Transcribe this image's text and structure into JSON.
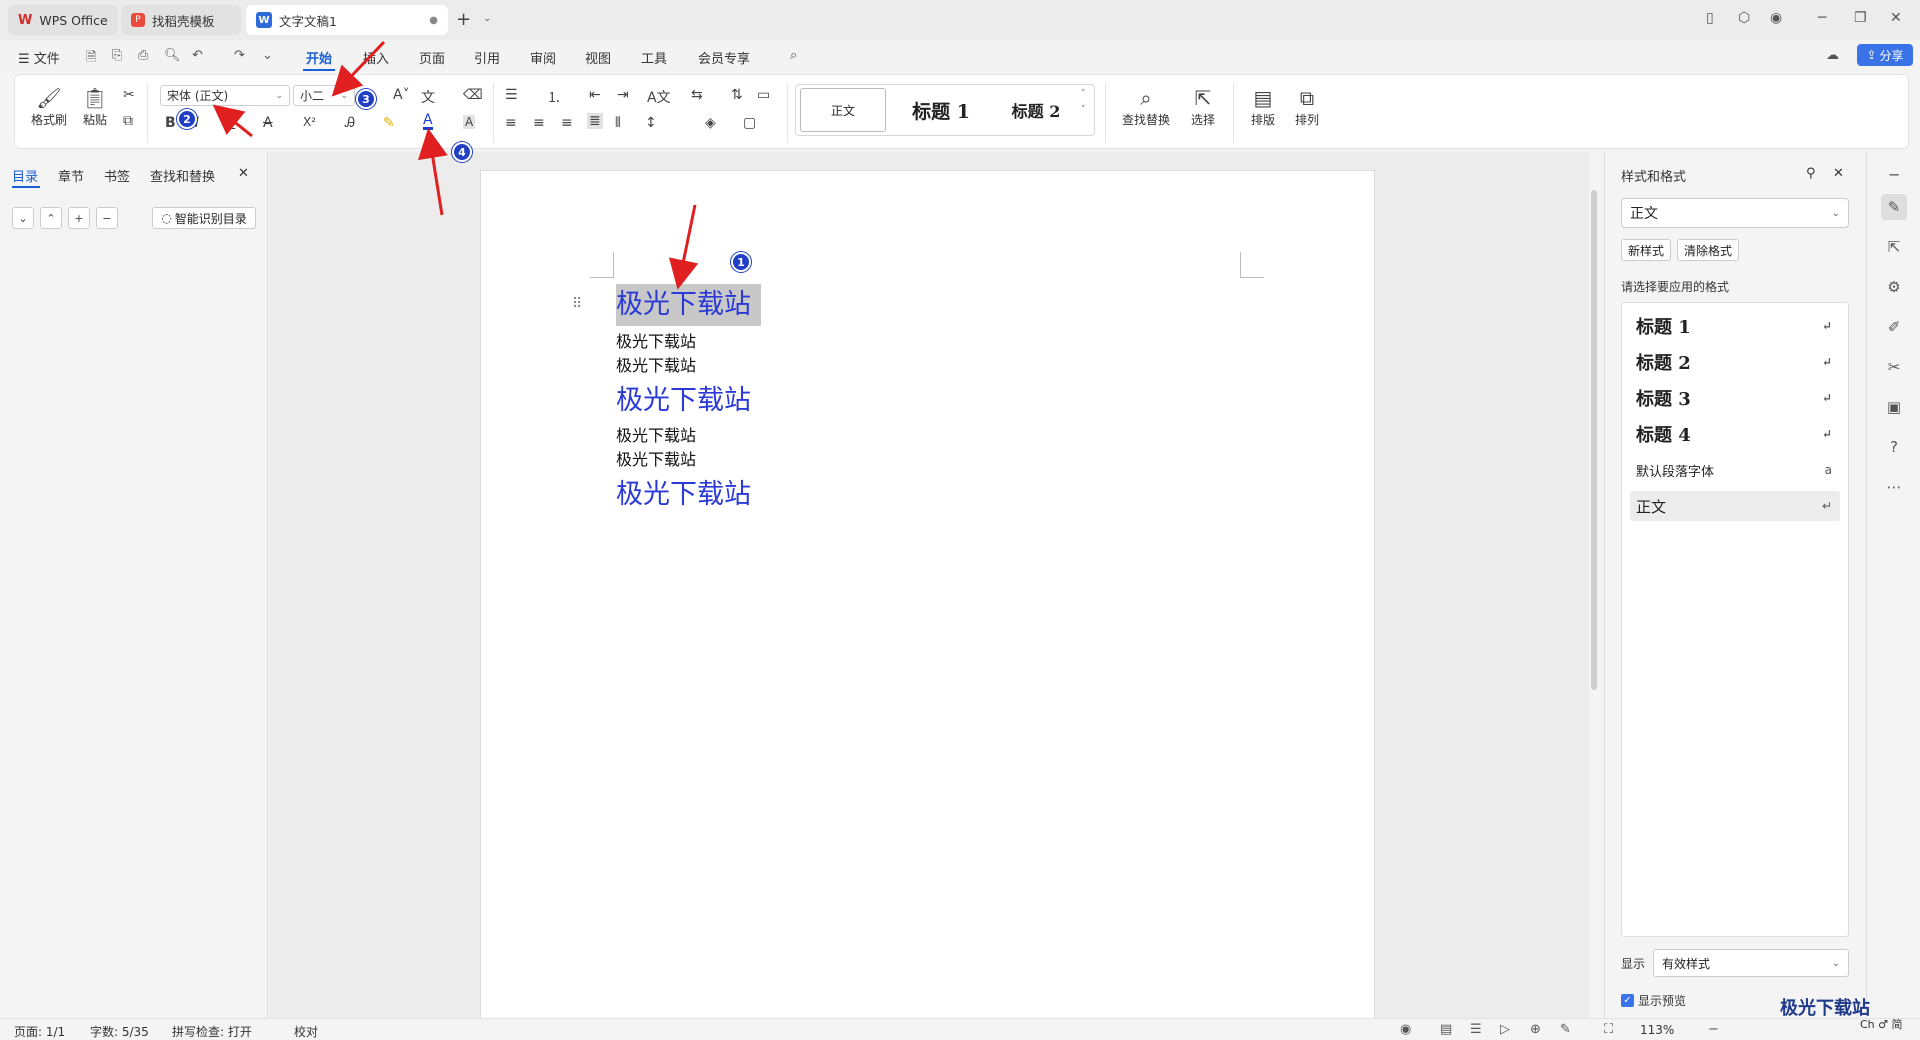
{
  "tabs": [
    {
      "label": "WPS Office"
    },
    {
      "label": "找稻壳模板"
    },
    {
      "label": "文字文稿1"
    }
  ],
  "menu": {
    "file": "文件",
    "items": [
      "开始",
      "插入",
      "页面",
      "引用",
      "审阅",
      "视图",
      "工具",
      "会员专享"
    ],
    "share": "分享"
  },
  "ribbon": {
    "format_painter": "格式刷",
    "paste": "粘贴",
    "font_name": "宋体 (正文)",
    "font_size": "小二",
    "styles": {
      "normal": "正文",
      "h1": "标题 1",
      "h2": "标题 2"
    },
    "find_replace": "查找替换",
    "select": "选择",
    "layout": "排版",
    "arrange": "排列",
    "bold": "B",
    "italic": "I",
    "underline": "U",
    "strike": "A",
    "super": "X²",
    "font_color": "A"
  },
  "left_panel": {
    "tabs": [
      "目录",
      "章节",
      "书签",
      "查找和替换"
    ],
    "smart_btn": "智能识别目录"
  },
  "document": {
    "lines": [
      {
        "text": "极光下载站",
        "type": "big"
      },
      {
        "text": "极光下载站",
        "type": "small"
      },
      {
        "text": "极光下载站",
        "type": "small"
      },
      {
        "text": "极光下载站",
        "type": "big"
      },
      {
        "text": "极光下载站",
        "type": "small"
      },
      {
        "text": "极光下载站",
        "type": "small"
      },
      {
        "text": "极光下载站",
        "type": "big"
      }
    ]
  },
  "right_panel": {
    "title": "样式和格式",
    "current": "正文",
    "new_style": "新样式",
    "clear_format": "清除格式",
    "label": "请选择要应用的格式",
    "styles": [
      "标题 1",
      "标题 2",
      "标题 3",
      "标题 4",
      "默认段落字体",
      "正文"
    ],
    "show_label": "显示",
    "show_value": "有效样式",
    "preview": "显示预览"
  },
  "status": {
    "page": "页面: 1/1",
    "words": "字数: 5/35",
    "spell": "拼写检查: 打开",
    "proof": "校对",
    "zoom": "113%"
  },
  "badges": [
    "1",
    "2",
    "3",
    "4"
  ],
  "watermark": {
    "name": "极光下载站",
    "site": "Ch ♂ 简"
  },
  "colors": {
    "accent": "#1a5fd6",
    "heading": "#2b3ad6",
    "badge": "#1f3fc4",
    "arrow": "#e02020"
  }
}
